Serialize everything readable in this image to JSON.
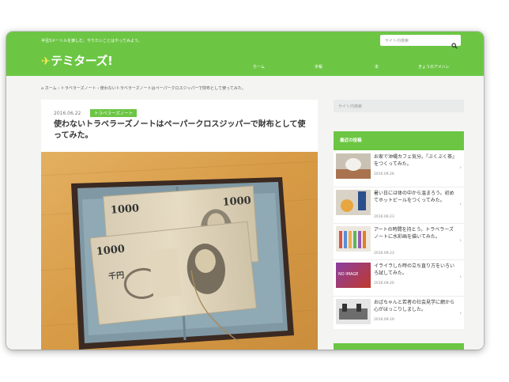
{
  "header": {
    "tagline": "半径3メートルを楽しむ、やりたいことはやってみよう。",
    "search_placeholder": "サイト内検索",
    "logo_text": "テミターズ!",
    "nav": [
      "ホーム",
      "手帳",
      "本",
      "きょうのアメハレ"
    ]
  },
  "breadcrumb": {
    "home": "ホーム",
    "category": "トラベラーズノート",
    "current": "使わないトラベラーズノートはペーパークロスジッパーで財布として使ってみた。"
  },
  "article": {
    "date": "2016.06.22",
    "category": "トラベラーズノート",
    "title": "使わないトラベラーズノートはペーパークロスジッパーで財布として使ってみた。",
    "banknote_value": "1000",
    "banknote_kanji": "千円"
  },
  "sidebar": {
    "search_placeholder": "サイト内検索",
    "recent_heading": "最近の投稿",
    "posts": [
      {
        "title": "お家で沖縄カフェ気分。『ぶくぶく茶』をつくってみた。",
        "date": "2016.09.26"
      },
      {
        "title": "暑い日には体の中から温まろう。初めてホットビールをつくってみた。",
        "date": "2016.09.23"
      },
      {
        "title": "アートの時間を持とう。トラベラーズノートに水彩画を描いてみた。",
        "date": "2016.09.23"
      },
      {
        "title": "イライラした時の立ち直り方をいろいろ試してみた。",
        "date": "2016.09.20",
        "thumb_text": "NO IMAGE"
      },
      {
        "title": "おばちゃんと若者の社会見学に網から心がほっこりしました。",
        "date": "2016.09.19"
      }
    ]
  },
  "colors": {
    "accent": "#6cc644",
    "logo_runner": "#ffe94d"
  }
}
